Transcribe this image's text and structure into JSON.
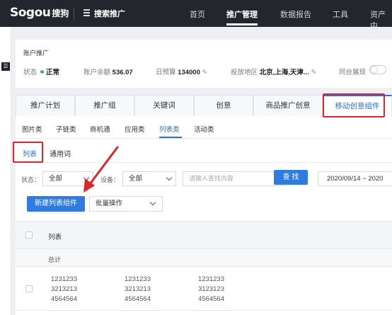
{
  "topbar": {
    "logo_brand": "Sogou",
    "logo_cn": "搜狗",
    "menu_label": "搜索推广",
    "nav": [
      "首页",
      "推广管理",
      "数据报告",
      "工具",
      "资产中"
    ]
  },
  "leftstrip": {
    "toggle_glyph": "☰"
  },
  "account": {
    "title": "账户推广",
    "status_label": "状态",
    "status_value": "正常",
    "balance_label": "账户余额",
    "balance_value": "536.07",
    "budget_label": "日预算",
    "budget_value": "134000",
    "region_label": "投放地区",
    "region_value": "北京,上海,天津...",
    "same_show_label": "同台展现",
    "edit_glyph": "✎"
  },
  "tabs": [
    "推广计划",
    "推广组",
    "关键词",
    "创意",
    "商品推广创意",
    "移动创意组件"
  ],
  "subtabs": [
    "图片类",
    "子链类",
    "商机通",
    "应用类",
    "列表类",
    "活动类"
  ],
  "typetabs": [
    "列表",
    "通用词"
  ],
  "filters": {
    "status_label": "状态：",
    "status_value": "全部",
    "device_label": "设备：",
    "device_value": "全部",
    "search_placeholder": "请输入查找内容",
    "search_button": "查 找",
    "date_range": "2020/09/14  ~  2020"
  },
  "actions": {
    "new_button": "新建列表组件",
    "batch_label": "批量操作"
  },
  "table": {
    "header": "列表",
    "total_label": "总计",
    "row": {
      "col1": [
        "1231233",
        "3213213",
        "4564564"
      ],
      "col2": [
        "1231233",
        "3213213",
        "4564564"
      ],
      "col3": [
        "1231233",
        "3123123",
        "4564564"
      ]
    }
  },
  "colors": {
    "accent": "#2f7be0",
    "highlight": "#e0242b",
    "topbar": "#23262d"
  }
}
